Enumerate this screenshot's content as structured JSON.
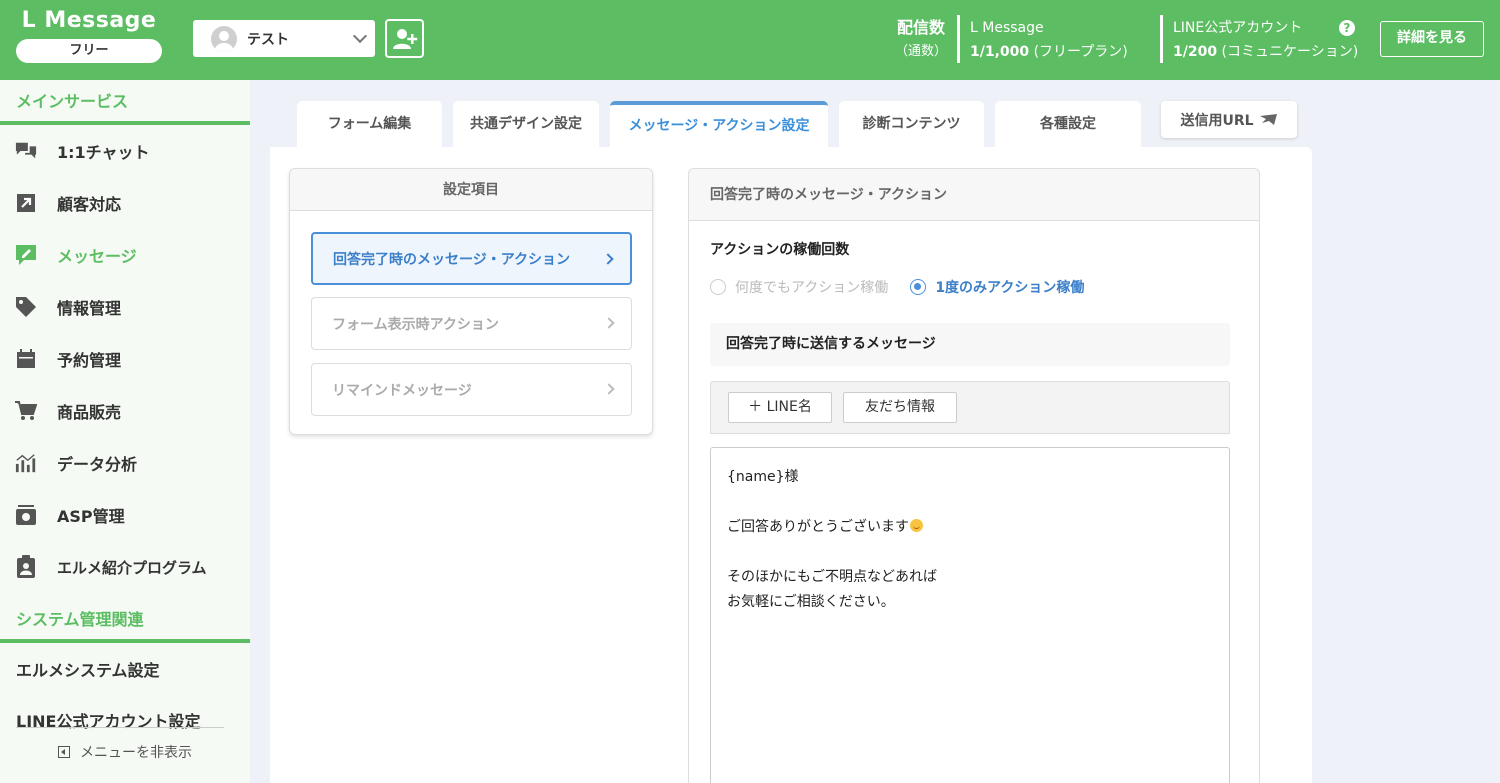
{
  "header": {
    "logo": "L Message",
    "plan": "フリー",
    "account_name": "テスト",
    "delivery_label": "配信数",
    "delivery_sub": "（通数）",
    "lmessage_label": "L Message",
    "lmessage_count": "1/1,000",
    "lmessage_plan": "(フリープラン)",
    "line_label": "LINE公式アカウント",
    "line_count": "1/200",
    "line_plan": "(コミュニケーション)",
    "help": "?",
    "detail_button": "詳細を見る",
    "accent_color": "#5cbd63"
  },
  "sidebar": {
    "main_section": "メインサービス",
    "items": [
      {
        "label": "1:1チャット",
        "icon": "chat-bubbles-icon"
      },
      {
        "label": "顧客対応",
        "icon": "arrow-up-right-icon"
      },
      {
        "label": "メッセージ",
        "icon": "pencil-message-icon"
      },
      {
        "label": "情報管理",
        "icon": "tag-icon"
      },
      {
        "label": "予約管理",
        "icon": "calendar-icon"
      },
      {
        "label": "商品販売",
        "icon": "cart-icon"
      },
      {
        "label": "データ分析",
        "icon": "chart-icon"
      },
      {
        "label": "ASP管理",
        "icon": "inbox-icon"
      },
      {
        "label": "エルメ紹介プログラム",
        "icon": "clipboard-user-icon"
      }
    ],
    "system_section": "システム管理関連",
    "system_items": [
      "エルメシステム設定",
      "LINE公式アカウント設定"
    ],
    "hide_menu": "メニューを非表示"
  },
  "tabs": [
    {
      "label": "フォーム編集"
    },
    {
      "label": "共通デザイン設定"
    },
    {
      "label": "メッセージ・アクション設定"
    },
    {
      "label": "診断コンテンツ"
    },
    {
      "label": "各種設定"
    }
  ],
  "url_button": "送信用URL",
  "settings": {
    "title": "設定項目",
    "items": [
      "回答完了時のメッセージ・アクション",
      "フォーム表示時アクション",
      "リマインドメッセージ"
    ]
  },
  "action": {
    "title": "回答完了時のメッセージ・アクション",
    "count_label": "アクションの稼働回数",
    "option_any": "何度でもアクション稼働",
    "option_once": "1度のみアクション稼働",
    "message_label": "回答完了時に送信するメッセージ",
    "insert_line_name": "＋ LINE名",
    "insert_friend_info": "友だち情報",
    "message_lines": [
      "{name}様",
      "",
      "ご回答ありがとうございます",
      "",
      "そのほかにもご不明点などあれば",
      "お気軽にご相談ください。"
    ]
  }
}
